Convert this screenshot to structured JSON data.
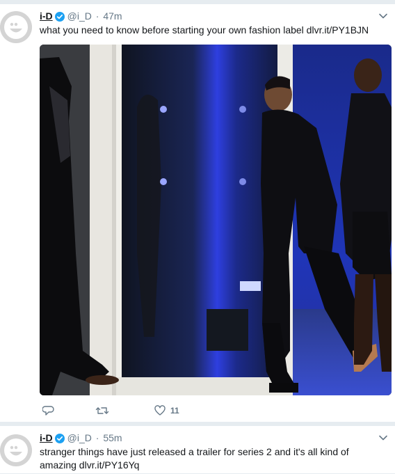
{
  "feed": {
    "tweets": [
      {
        "name": "i-D",
        "handle": "@i_D",
        "separator": "·",
        "time": "47m",
        "text": "what you need to know before starting your own fashion label dlvr.it/PY1BJN",
        "has_media": true,
        "actions": {
          "like_count": "11"
        }
      },
      {
        "name": "i-D",
        "handle": "@i_D",
        "separator": "·",
        "time": "55m",
        "text": "stranger things have just released a trailer for series 2 and it's all kind of amazing dlvr.it/PY16Yq",
        "has_media": false
      }
    ]
  },
  "colors": {
    "background": "#e6ecf0",
    "verified_blue": "#1da1f2",
    "muted_text": "#657786",
    "stage_blue": "#2a3fd9"
  },
  "icons": [
    "avatar-smiley",
    "verified-badge-icon",
    "chevron-down-icon",
    "reply-icon",
    "retweet-icon",
    "heart-icon"
  ]
}
